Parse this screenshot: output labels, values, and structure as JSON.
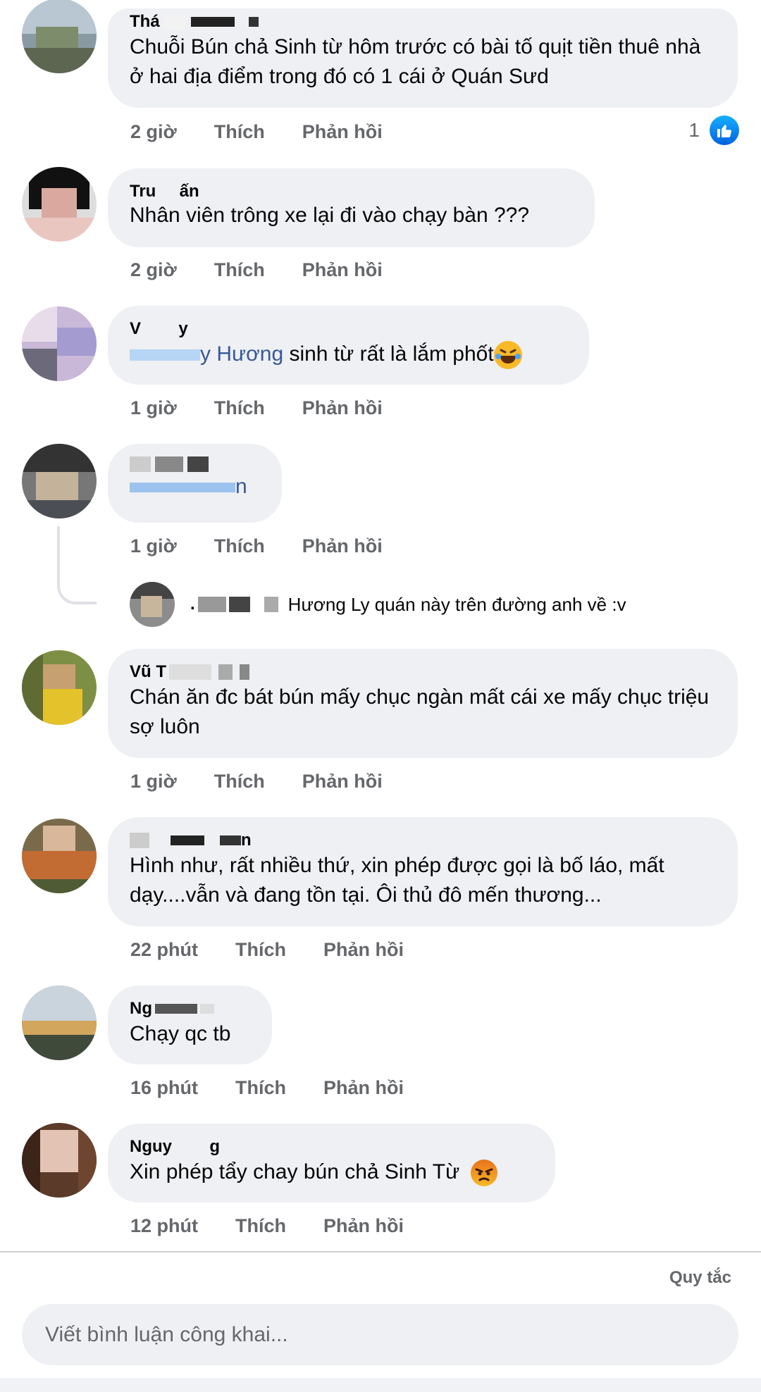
{
  "comments": [
    {
      "author": "Thá",
      "text": "Chuỗi Bún chả Sinh từ hôm trước có bài tố quịt tiền thuê nhà ở hai địa điểm trong đó có 1 cái ở Quán Sưd",
      "time": "2 giờ",
      "like_label": "Thích",
      "reply_label": "Phản hồi",
      "reaction_count": "1"
    },
    {
      "author": "Tru     ấn",
      "text": "Nhân viên trông xe lại đi vào chạy bàn ???",
      "time": "2 giờ",
      "like_label": "Thích",
      "reply_label": "Phản hồi"
    },
    {
      "author": "V        y",
      "mention": "y Hương",
      "text": " sinh từ rất là lắm phốt",
      "time": "1 giờ",
      "like_label": "Thích",
      "reply_label": "Phản hồi"
    },
    {
      "author": "",
      "mention": "n",
      "time": "1 giờ",
      "like_label": "Thích",
      "reply_label": "Phản hồi"
    },
    {
      "author": "Vũ T",
      "text": "Chán ăn đc bát bún mấy chục ngàn mất cái xe mấy chục triệu sợ luôn",
      "time": "1 giờ",
      "like_label": "Thích",
      "reply_label": "Phản hồi"
    },
    {
      "author": "n",
      "text": "Hình như, rất nhiều thứ, xin phép được gọi là bố láo, mất dạy....vẫn và đang tồn tại. Ôi thủ đô mến thương...",
      "time": "22 phút",
      "like_label": "Thích",
      "reply_label": "Phản hồi"
    },
    {
      "author": "Ng",
      "text": "Chạy qc tb",
      "time": "16 phút",
      "like_label": "Thích",
      "reply_label": "Phản hồi"
    },
    {
      "author": "Nguy        g",
      "text": "Xin phép tẩy chay bún chả Sinh Từ",
      "time": "12 phút",
      "like_label": "Thích",
      "reply_label": "Phản hồi"
    }
  ],
  "reply_preview": {
    "author_prefix": ".",
    "text": "Hương Ly quán này trên đường anh về :v"
  },
  "footer": {
    "rules_label": "Quy tắc",
    "composer_placeholder": "Viết bình luận công khai..."
  },
  "colors": {
    "bubble": "#eef0f3",
    "meta_text": "#65676b",
    "mention": "#385898",
    "like_blue": "#1877f2"
  },
  "icons": {
    "reaction": "like-thumb-icon",
    "laugh": "laughing-emoji-icon",
    "angry": "angry-emoji-icon"
  }
}
